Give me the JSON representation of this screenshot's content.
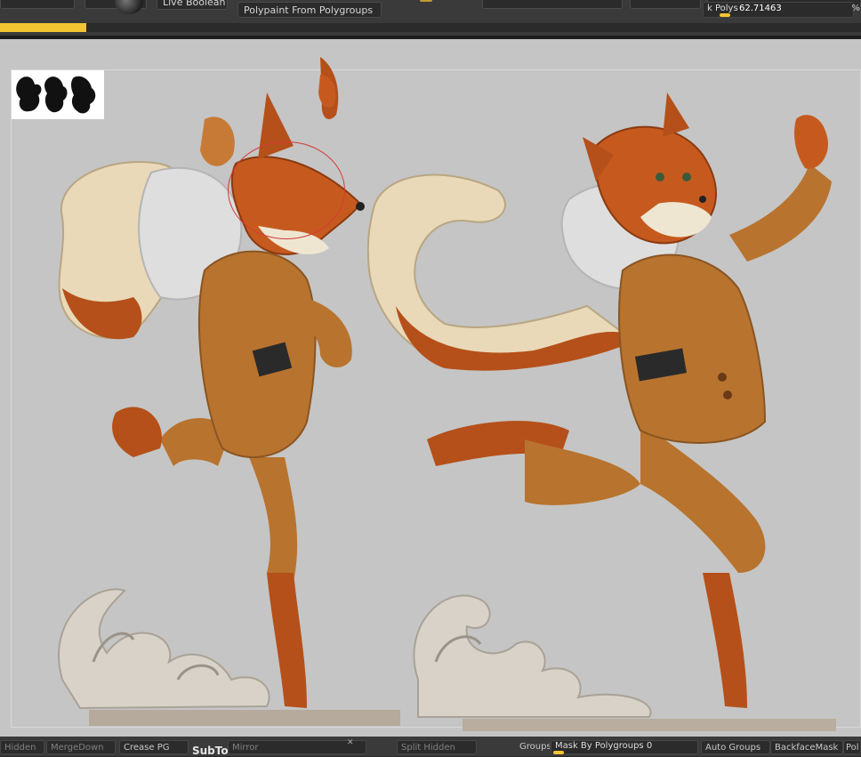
{
  "top_toolbar": {
    "live_boolean_label": "Live Boolean",
    "polypaint_from_polygroups_label": "Polypaint From Polygroups",
    "kpolys_label": "k Polys",
    "kpolys_value": "62.71463",
    "kpolys_unit": "%"
  },
  "progress": {
    "fraction": 0.1
  },
  "bottom_toolbar": {
    "hidden_label": "Hidden",
    "merge_down_label": "MergeDown",
    "crease_pg_label": "Crease PG",
    "subtool_label": "SubTool",
    "mirror_label": "Mirror",
    "split_hidden_label": "Split Hidden",
    "groups_label": "Groups",
    "mask_by_polygroups_label": "Mask By Polygroups",
    "mask_by_polygroups_value": "0",
    "auto_groups_label": "Auto Groups",
    "backface_mask_label": "BackfaceMask",
    "truncated_label": "Pol"
  },
  "colors": {
    "accent": "#f2c531",
    "ui_bg": "#3a3a3a",
    "viewport_bg": "#c5c5c5",
    "fox_fur": "#b5501a",
    "coat": "#b8732e",
    "cream": "#e9d9b8",
    "sack": "#dedede",
    "cloud": "#d8d2c8"
  }
}
